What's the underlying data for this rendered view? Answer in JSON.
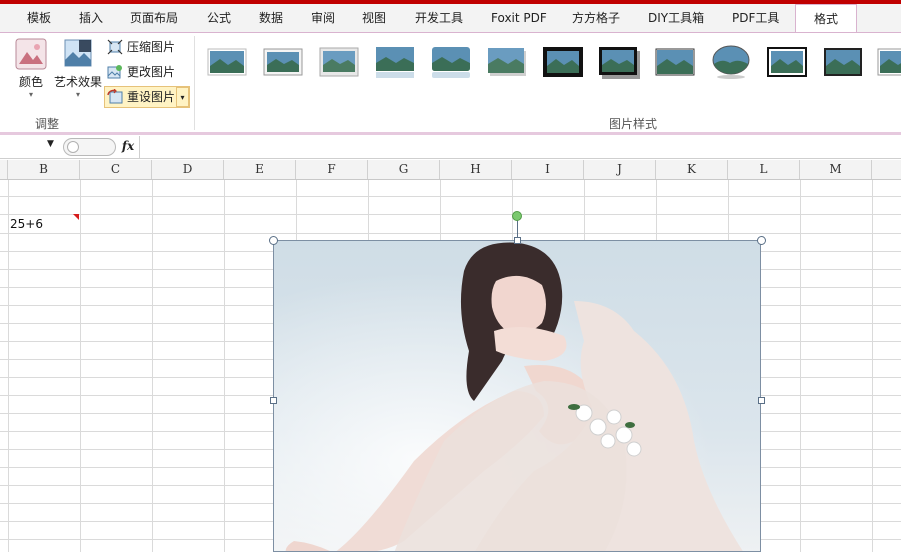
{
  "tabs": [
    {
      "label": "模板",
      "active": false
    },
    {
      "label": "插入",
      "active": false
    },
    {
      "label": "页面布局",
      "active": false
    },
    {
      "label": "公式",
      "active": false
    },
    {
      "label": "数据",
      "active": false
    },
    {
      "label": "审阅",
      "active": false
    },
    {
      "label": "视图",
      "active": false
    },
    {
      "label": "开发工具",
      "active": false
    },
    {
      "label": "Foxit PDF",
      "active": false
    },
    {
      "label": "方方格子",
      "active": false
    },
    {
      "label": "DIY工具箱",
      "active": false
    },
    {
      "label": "PDF工具",
      "active": false
    },
    {
      "label": "格式",
      "active": true
    }
  ],
  "ribbon": {
    "adjust_group": {
      "label": "调整",
      "color_label": "颜色",
      "art_effects_label": "艺术效果",
      "compress_label": "压缩图片",
      "change_label": "更改图片",
      "reset_label": "重设图片"
    },
    "styles_group": {
      "label": "图片样式",
      "style_count": 14
    }
  },
  "formula_bar": {
    "name_box": "",
    "fx_label": "fx",
    "content": ""
  },
  "columns": [
    "B",
    "C",
    "D",
    "E",
    "F",
    "G",
    "H",
    "I",
    "J",
    "K",
    "L",
    "M"
  ],
  "cells": {
    "b3": "25+6"
  },
  "colors": {
    "accent": "#c00000",
    "ribbon_border": "#d9b3cf",
    "selection_border": "#5a6f86",
    "rotate_handle": "#5cb85c"
  }
}
